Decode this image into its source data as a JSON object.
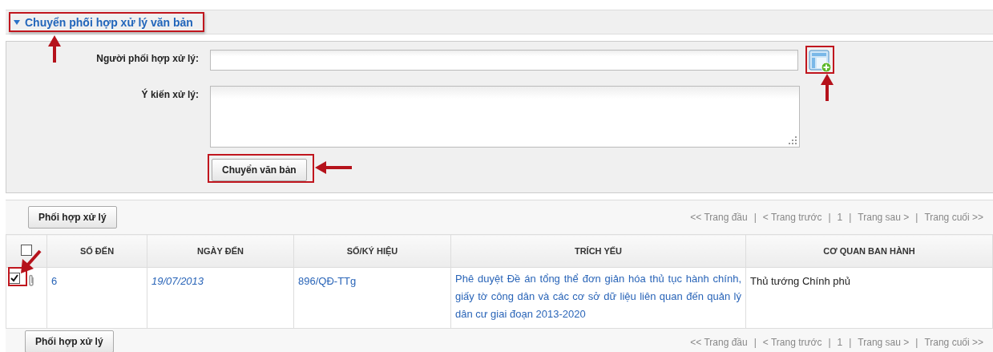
{
  "section": {
    "title": "Chuyển phối hợp xử lý văn bản",
    "expanded": true
  },
  "form": {
    "fields": [
      {
        "label": "Người phối hợp xử lý:",
        "kind": "input"
      },
      {
        "label": "Ý kiến xử lý:",
        "kind": "textarea"
      }
    ],
    "submit": "Chuyển văn bản"
  },
  "top_toolbar": {
    "button": "Phối hợp xử lý",
    "pager": [
      "<< Trang đầu",
      "|",
      "< Trang trước",
      "|",
      "1",
      "|",
      "Trang sau >",
      "|",
      "Trang cuối >>"
    ]
  },
  "table": {
    "select_all": {
      "checked": false
    },
    "columns": [
      "SỐ ĐẾN",
      "NGÀY ĐẾN",
      "SỐ/KÝ HIỆU",
      "TRÍCH YẾU",
      "CƠ QUAN BAN HÀNH"
    ],
    "rows": [
      {
        "checked": true,
        "attachment": true,
        "number": "6",
        "date": "19/07/2013",
        "code": "896/QĐ-TTg",
        "summary": "Phê duyệt Đề án tổng thể đơn giản hóa thủ tục hành chính, giấy tờ công dân và các cơ sở dữ liệu liên quan đến quản lý dân cư giai đoạn 2013-2020",
        "issuer": "Thủ tướng Chính phủ"
      }
    ]
  },
  "bottom_toolbar": {
    "button": "Phối hợp xử lý",
    "pager": [
      "<< Trang đầu",
      "|",
      "< Trang trước",
      "|",
      "1",
      "|",
      "Trang sau >",
      "|",
      "Trang cuối >>"
    ]
  }
}
